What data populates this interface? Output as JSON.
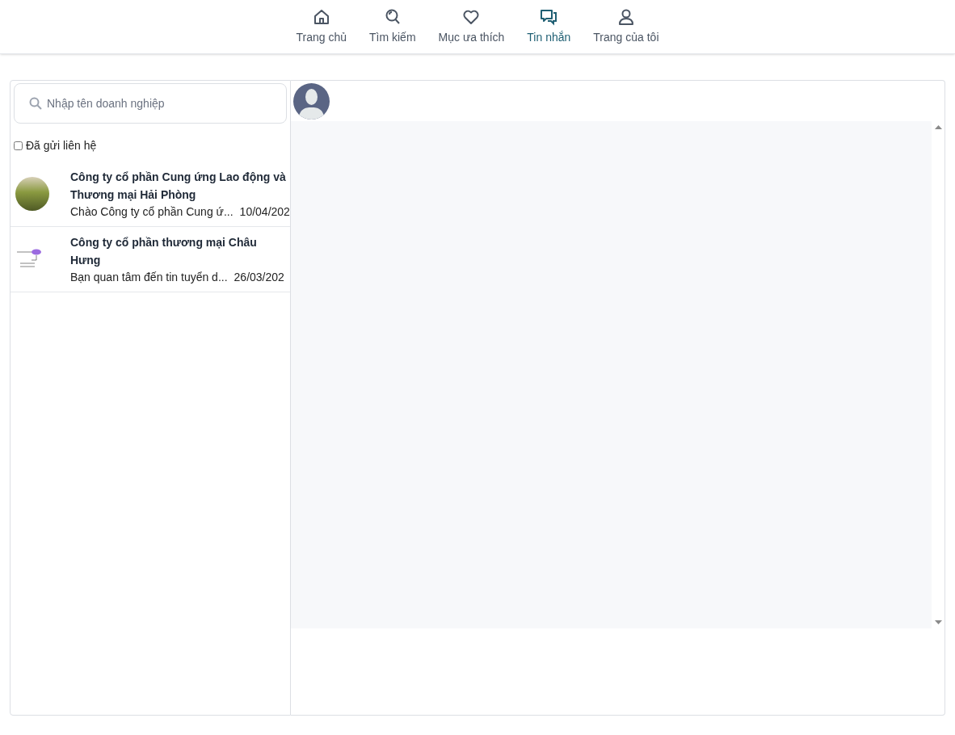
{
  "nav": [
    {
      "kind": "home",
      "label": "Trang chủ",
      "selected": false
    },
    {
      "kind": "search",
      "label": "Tìm kiếm",
      "selected": false
    },
    {
      "kind": "heart",
      "label": "Mục ưa thích",
      "selected": false
    },
    {
      "kind": "chat",
      "label": "Tin nhắn",
      "selected": true
    },
    {
      "kind": "user",
      "label": "Trang của tôi",
      "selected": false
    }
  ],
  "search": {
    "placeholder": "Nhập tên doanh nghiệp"
  },
  "filter": {
    "label": "Đã gửi liên hệ",
    "checked": false
  },
  "conversations": [
    {
      "kind": "photo",
      "name": "Công ty cổ phần Cung ứng Lao động và Thương mại Hải Phòng",
      "preview": "Chào Công ty cổ phần Cung ứ...",
      "date": "10/04/202"
    },
    {
      "kind": "logo",
      "name": "Công ty cổ phần thương mại Châu Hưng",
      "preview": "Bạn quan tâm đến tin tuyển d...",
      "date": "26/03/202"
    }
  ]
}
